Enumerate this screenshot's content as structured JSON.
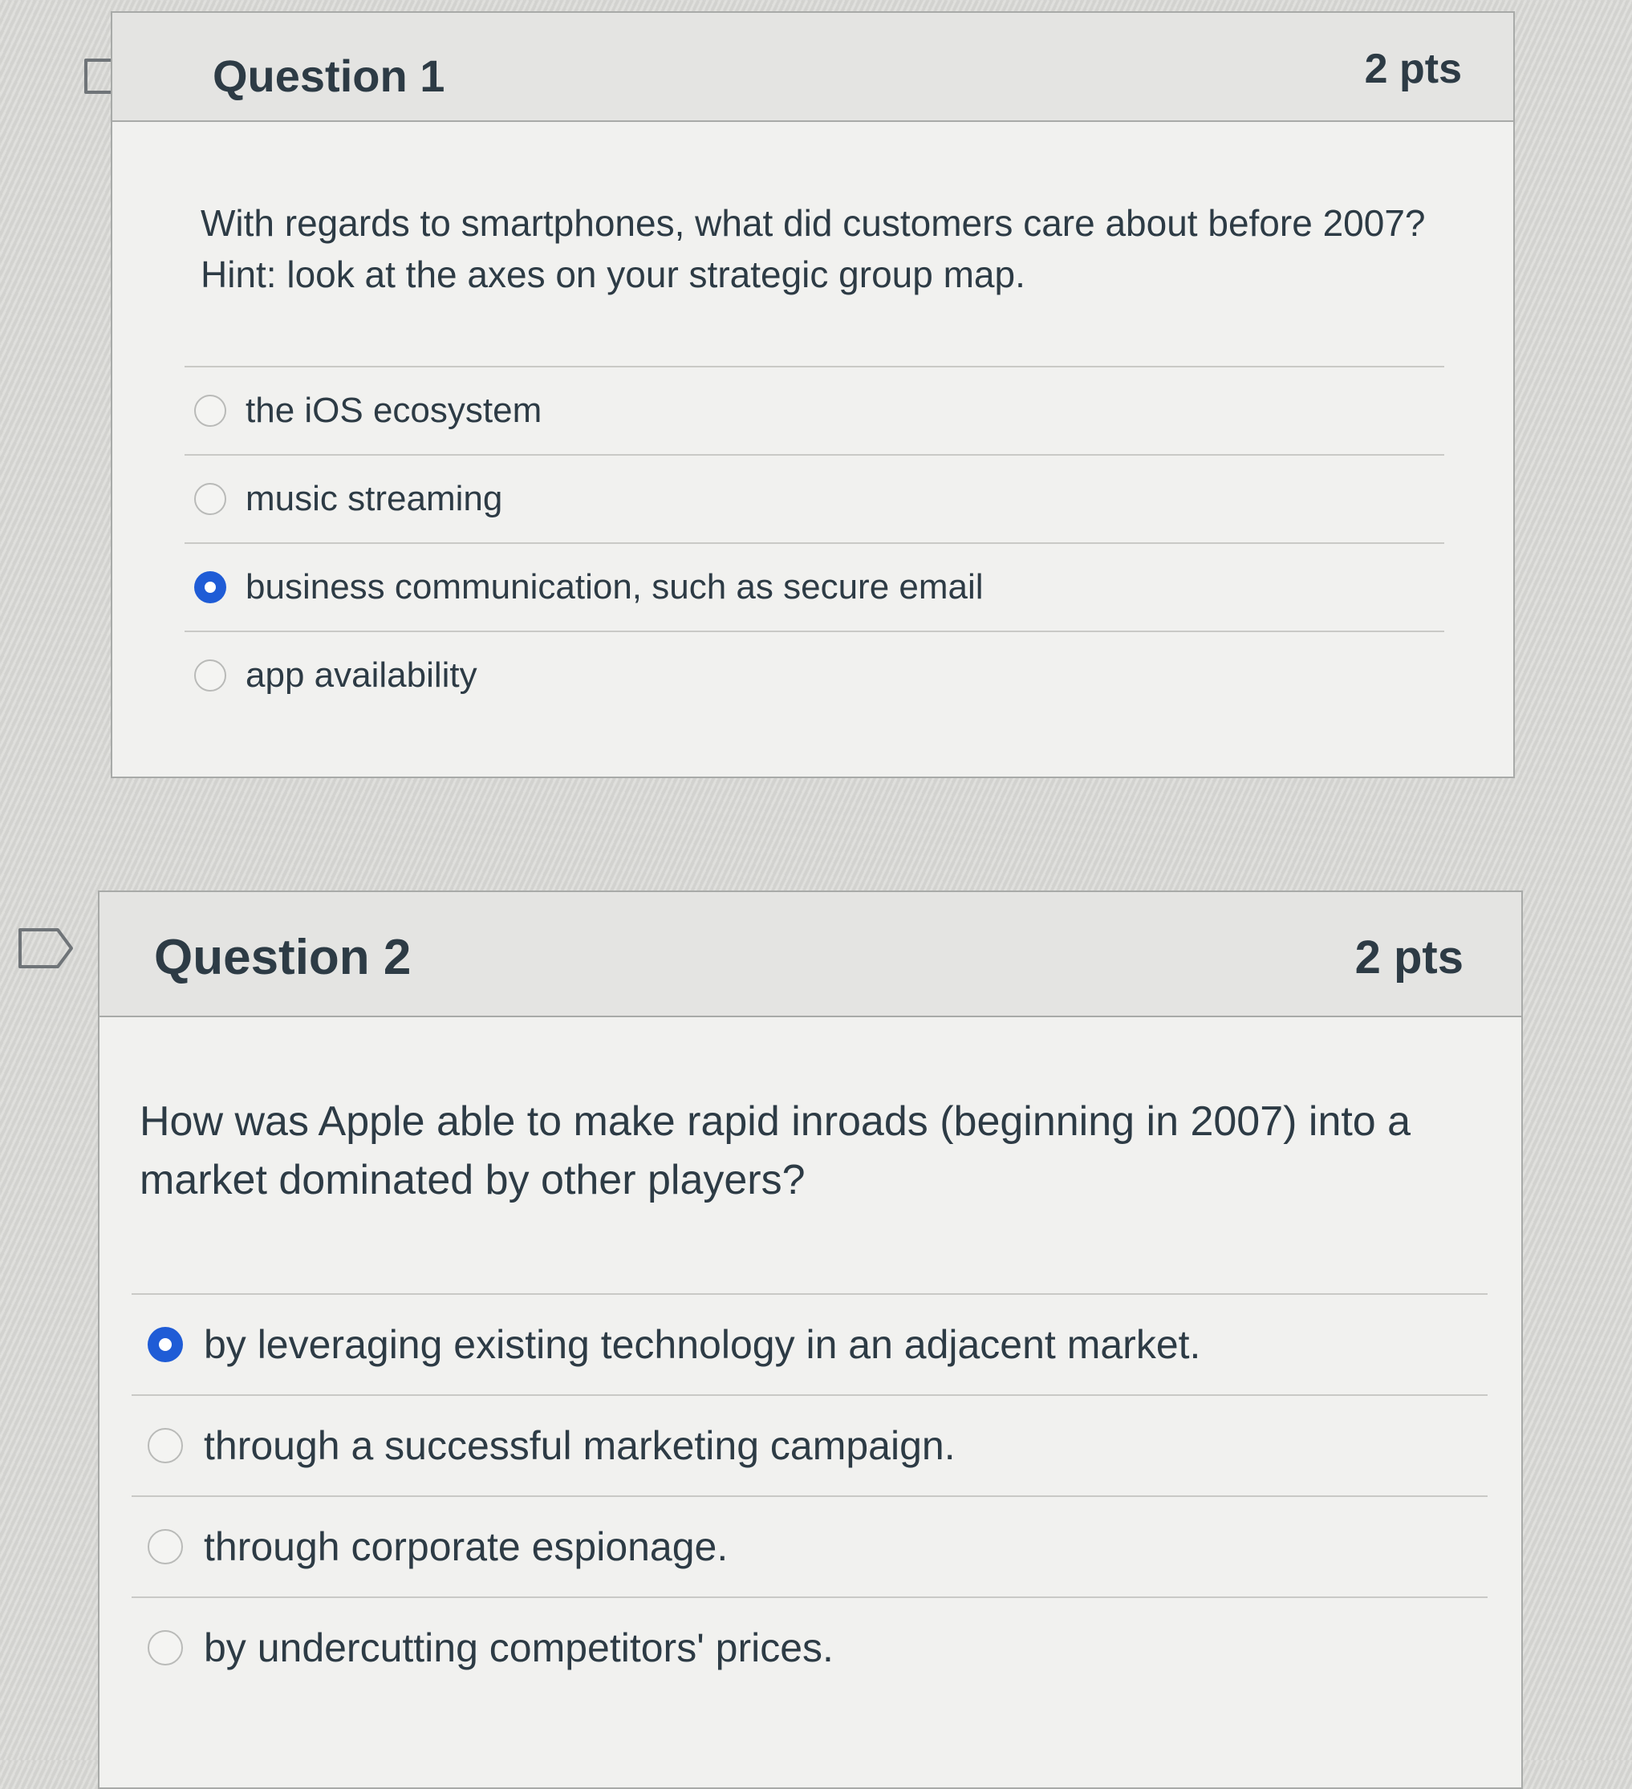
{
  "questions": [
    {
      "title": "Question 1",
      "points": "2 pts",
      "text": "With regards to smartphones, what did customers care about before 2007? Hint: look at the axes on your strategic group map.",
      "answers": [
        {
          "label": "the iOS ecosystem",
          "selected": false
        },
        {
          "label": "music streaming",
          "selected": false
        },
        {
          "label": "business communication, such as secure email",
          "selected": true
        },
        {
          "label": "app availability",
          "selected": false
        }
      ]
    },
    {
      "title": "Question 2",
      "points": "2 pts",
      "text": "How was Apple able to make rapid inroads (beginning in 2007) into a market dominated by other players?",
      "answers": [
        {
          "label": "by leveraging existing technology in an adjacent market.",
          "selected": true
        },
        {
          "label": "through a successful marketing campaign.",
          "selected": false
        },
        {
          "label": "through corporate espionage.",
          "selected": false
        },
        {
          "label": "by undercutting competitors' prices.",
          "selected": false
        }
      ]
    }
  ],
  "colors": {
    "radio_selected": "#1f5cd6",
    "text": "#2d3b45",
    "card_background": "#f1f1ef",
    "header_background": "#e4e4e2"
  },
  "icons": {
    "flag": "flag-outline-icon"
  }
}
